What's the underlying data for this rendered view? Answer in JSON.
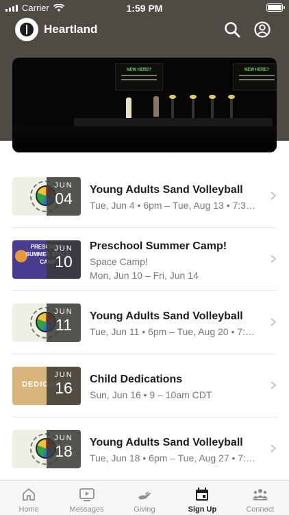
{
  "status_bar": {
    "carrier": "Carrier",
    "time": "1:59 PM"
  },
  "header": {
    "title": "Heartland"
  },
  "hero": {
    "screen_left": "NEW HERE?",
    "screen_right": "NEW HERE?"
  },
  "events": [
    {
      "title": "Young Adults Sand Volleyball",
      "line1": "Tue, Jun 4 • 6pm – Tue, Aug 13 • 7:3…",
      "line2": "",
      "month": "JUN",
      "day": "04",
      "thumb": "volleyball"
    },
    {
      "title": "Preschool Summer Camp!",
      "line1": "Space Camp!",
      "line2": "Mon, Jun 10 – Fri, Jun 14",
      "month": "JUN",
      "day": "10",
      "thumb": "camp",
      "thumb_text": "PRESCHOOL SUMMER SPACE CAMP"
    },
    {
      "title": "Young Adults Sand Volleyball",
      "line1": "Tue, Jun 11 • 6pm – Tue, Aug 20 • 7:…",
      "line2": "",
      "month": "JUN",
      "day": "11",
      "thumb": "volleyball"
    },
    {
      "title": "Child Dedications",
      "line1": "Sun, Jun 16 • 9 – 10am CDT",
      "line2": "",
      "month": "JUN",
      "day": "16",
      "thumb": "dedication",
      "thumb_text": "DEDICAT"
    },
    {
      "title": "Young Adults Sand Volleyball",
      "line1": "Tue, Jun 18 • 6pm – Tue, Aug 27 • 7:…",
      "line2": "",
      "month": "JUN",
      "day": "18",
      "thumb": "volleyball"
    }
  ],
  "tabs": [
    {
      "label": "Home",
      "icon": "home-icon",
      "active": false
    },
    {
      "label": "Messages",
      "icon": "video-icon",
      "active": false
    },
    {
      "label": "Giving",
      "icon": "giving-hand-icon",
      "active": false
    },
    {
      "label": "Sign Up",
      "icon": "calendar-icon",
      "active": true
    },
    {
      "label": "Connect",
      "icon": "group-icon",
      "active": false
    }
  ],
  "colors": {
    "header_bg": "#4f4a43",
    "active_tab": "#1d1d1d",
    "inactive_tab": "#8e8e8e"
  }
}
